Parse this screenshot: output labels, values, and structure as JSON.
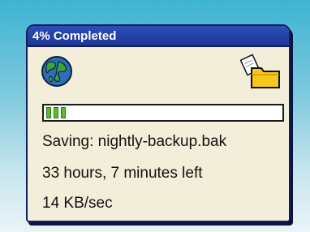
{
  "dialog": {
    "title": "4% Completed",
    "progress_percent": 4,
    "progress_segments": 3,
    "status_line": "Saving: nightly-backup.bak",
    "time_left": "33 hours, 7 minutes left",
    "speed": "14 KB/sec"
  },
  "colors": {
    "title_bar": "#1d3796",
    "window_bg": "#f2eed9",
    "progress_fill": "#5dbb2e",
    "border": "#0f1f5a"
  },
  "icons": [
    "globe-icon",
    "folder-icon"
  ]
}
